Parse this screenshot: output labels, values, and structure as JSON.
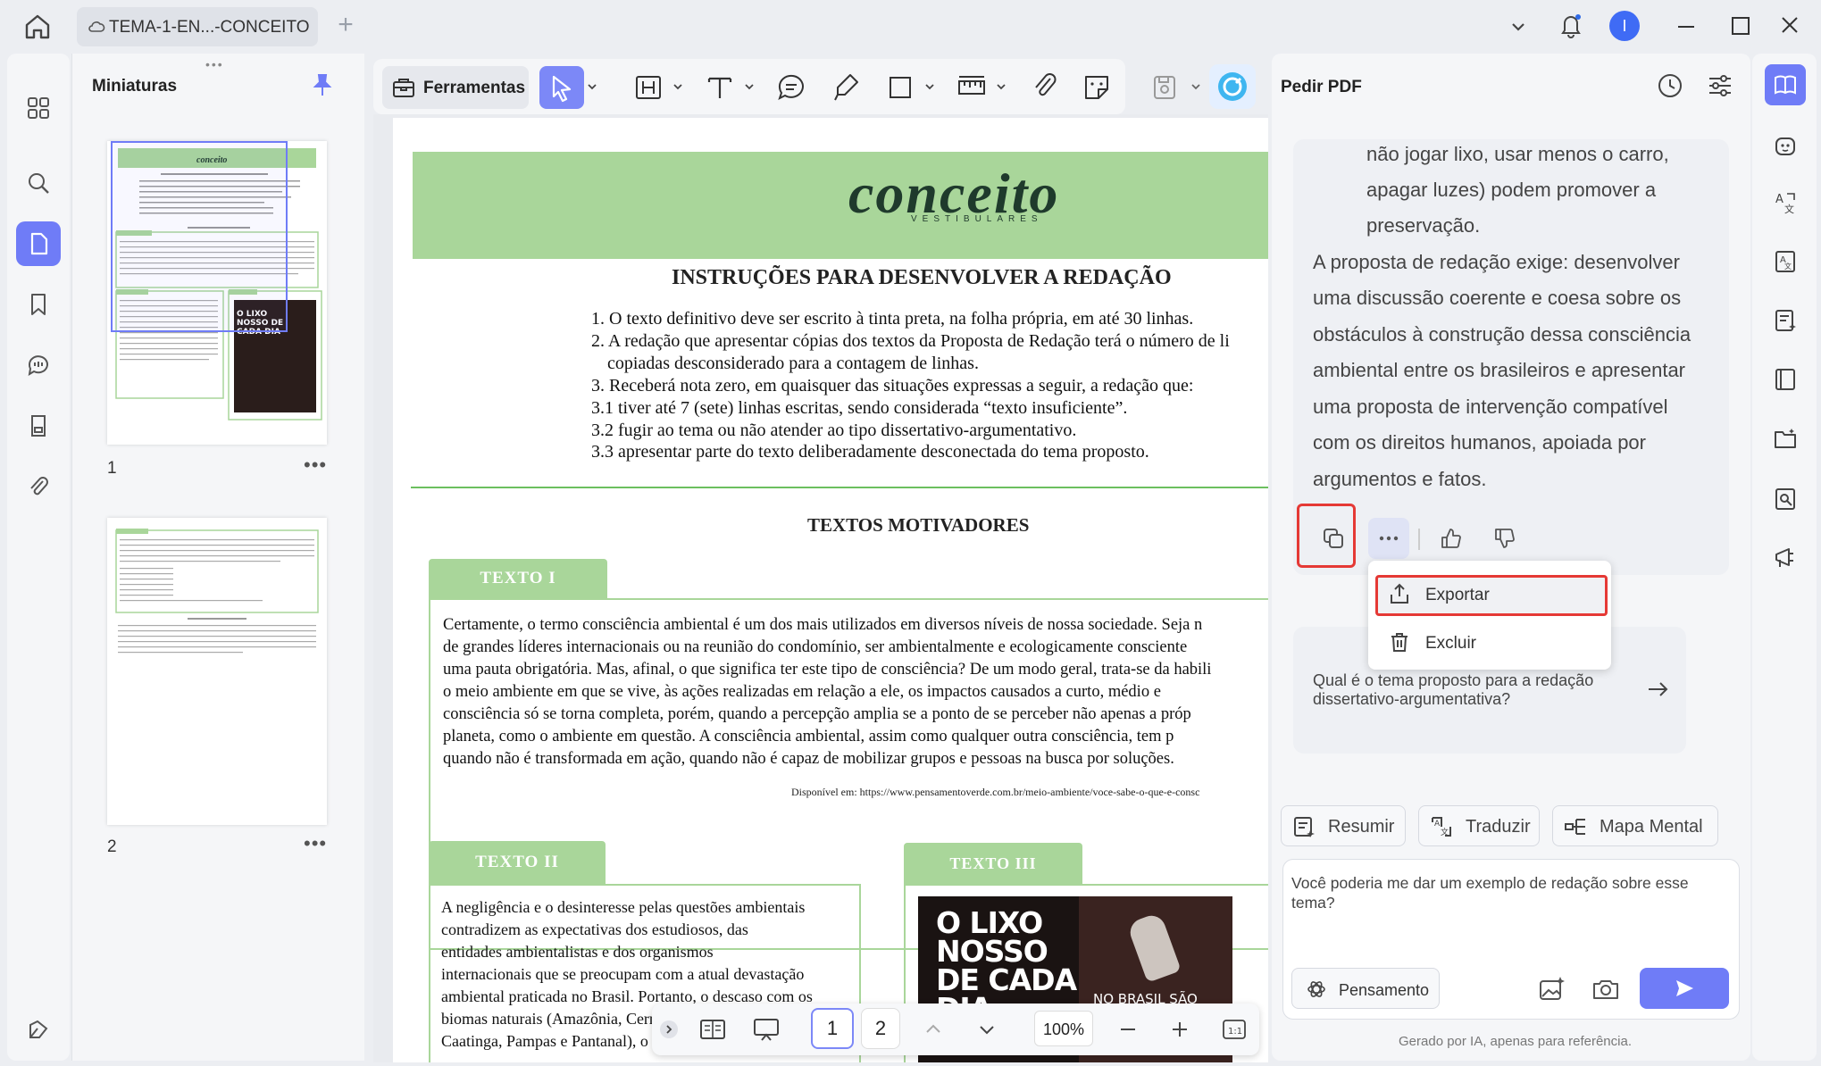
{
  "titlebar": {
    "doc_tab_title": "TEMA-1-EN...-CONCEITO",
    "new_tab": "+",
    "avatar_initial": "I"
  },
  "thumbnails": {
    "title": "Miniaturas",
    "grip": "•••",
    "pages": [
      {
        "number": "1",
        "more": "•••"
      },
      {
        "number": "2",
        "more": "•••"
      }
    ]
  },
  "toolbar": {
    "tools_label": "Ferramentas"
  },
  "document": {
    "brand": "conceito",
    "brand_sub": "VESTIBULARES",
    "instructions_title": "INSTRUÇÕES PARA DESENVOLVER A REDAÇÃO",
    "instructions": [
      "1. O texto definitivo deve ser escrito à tinta preta, na folha própria, em até 30 linhas.",
      "2. A redação que apresentar cópias dos textos da Proposta de Redação terá o número de li",
      "copiadas desconsiderado para a contagem de linhas.",
      "3. Receberá nota zero, em quaisquer das situações expressas a seguir, a redação que:",
      "3.1 tiver até 7 (sete) linhas escritas,  sendo considerada “texto insuficiente”.",
      "3.2 fugir ao tema ou não atender ao tipo dissertativo-argumentativo.",
      "3.3 apresentar parte do texto deliberadamente desconectada do tema proposto."
    ],
    "motivadores_title": "TEXTOS MOTIVADORES",
    "texto1_label": "TEXTO I",
    "texto1_lines": [
      "Certamente, o termo consciência ambiental é um dos mais utilizados em diversos níveis de nossa  sociedade. Seja n",
      "de grandes líderes internacionais ou na reunião do condomínio, ser ambientalmente e ecologicamente consciente ",
      "uma pauta obrigatória. Mas, afinal, o que significa ter este tipo de consciência? De um modo geral, trata-se da habili",
      "o meio ambiente em que se vive, às ações realizadas em relação a ele, os impactos causados   a  curto, médio e",
      "consciência só se torna completa, porém, quando a percepção amplia se a ponto de se perceber não apenas a próp",
      "planeta, como o ambiente em questão.  A consciência ambiental, assim como qualquer outra consciência, tem p",
      "quando não é transformada em ação, quando não é capaz de mobilizar grupos e pessoas na busca por soluções."
    ],
    "texto1_source": "Disponível em: https://www.pensamentoverde.com.br/meio-ambiente/voce-sabe-o-que-e-consc",
    "texto2_label": "TEXTO II",
    "texto2_lines": [
      "A negligência e o desinteresse pelas questões ambientais",
      "contradizem    as    expectativas    dos    estudiosos,    das",
      "entidades      ambientalistas      e      dos      organismos",
      "internacionais que se preocupam com a atual devastação",
      "ambiental praticada no Brasil. Portanto, o descaso com os",
      "biomas naturais (Amazônia, Cerrado, Pantanal, Mata",
      "Caatinga, Pampas e Pantanal), o desmatamento e a"
    ],
    "texto3_label": "TEXTO III",
    "texto3_image_title": "O LIXO NOSSO DE CADA DIA",
    "texto3_image_sub": "NO BRASIL SÃO"
  },
  "page_nav": {
    "page1": "1",
    "page2": "2",
    "zoom": "100%"
  },
  "ai": {
    "title": "Pedir PDF",
    "answer_lines": [
      "não jogar lixo, usar menos o carro,",
      "apagar luzes) podem promover a",
      "preservação.",
      "A proposta de redação exige: desenvolver",
      "uma discussão coerente e coesa sobre os",
      "obstáculos à construção dessa consciência",
      "ambiental entre os brasileiros e apresentar",
      "uma proposta de intervenção compatível",
      "com os direitos humanos, apoiada por",
      "argumentos e fatos."
    ],
    "menu_export": "Exportar",
    "menu_delete": "Excluir",
    "suggestion": "Qual é o tema proposto para a redação dissertativo-argumentativa?",
    "chip_summarize": "Resumir",
    "chip_translate": "Traduzir",
    "chip_mindmap": "Mapa Mental",
    "input_text": "Você poderia me dar um exemplo de redação sobre esse tema?",
    "think_label": "Pensamento",
    "disclaimer": "Gerado por IA, apenas para referência."
  },
  "colors": {
    "accent": "#6f7cf7",
    "doc_green": "#a9d69a",
    "highlight_red": "#e53935"
  },
  "icons": [
    "home-icon",
    "cloud-icon",
    "chevron-down-icon",
    "bell-icon",
    "minimize-icon",
    "maximize-icon",
    "close-icon",
    "grid-icon",
    "search-icon",
    "page-icon",
    "bookmark-icon",
    "comment-icon",
    "stamp-icon",
    "attachment-icon",
    "theme-icon",
    "pin-icon",
    "toolbox-icon",
    "cursor-icon",
    "heading-icon",
    "text-icon",
    "note-icon",
    "highlighter-icon",
    "rectangle-icon",
    "ruler-icon",
    "paperclip-icon",
    "sticker-icon",
    "save-icon",
    "ai-logo-icon",
    "history-icon",
    "sliders-icon",
    "copy-icon",
    "more-icon",
    "thumbs-up-icon",
    "thumbs-down-icon",
    "export-icon",
    "trash-icon",
    "arrow-right-icon",
    "summarize-icon",
    "translate-icon",
    "mindmap-icon",
    "atom-icon",
    "image-add-icon",
    "camera-icon",
    "send-icon",
    "book-ai-icon",
    "chatbot-icon",
    "translate-a-icon",
    "translate-page-icon",
    "form-ai-icon",
    "reader-icon",
    "folder-icon",
    "scan-icon",
    "presentation-icon"
  ]
}
